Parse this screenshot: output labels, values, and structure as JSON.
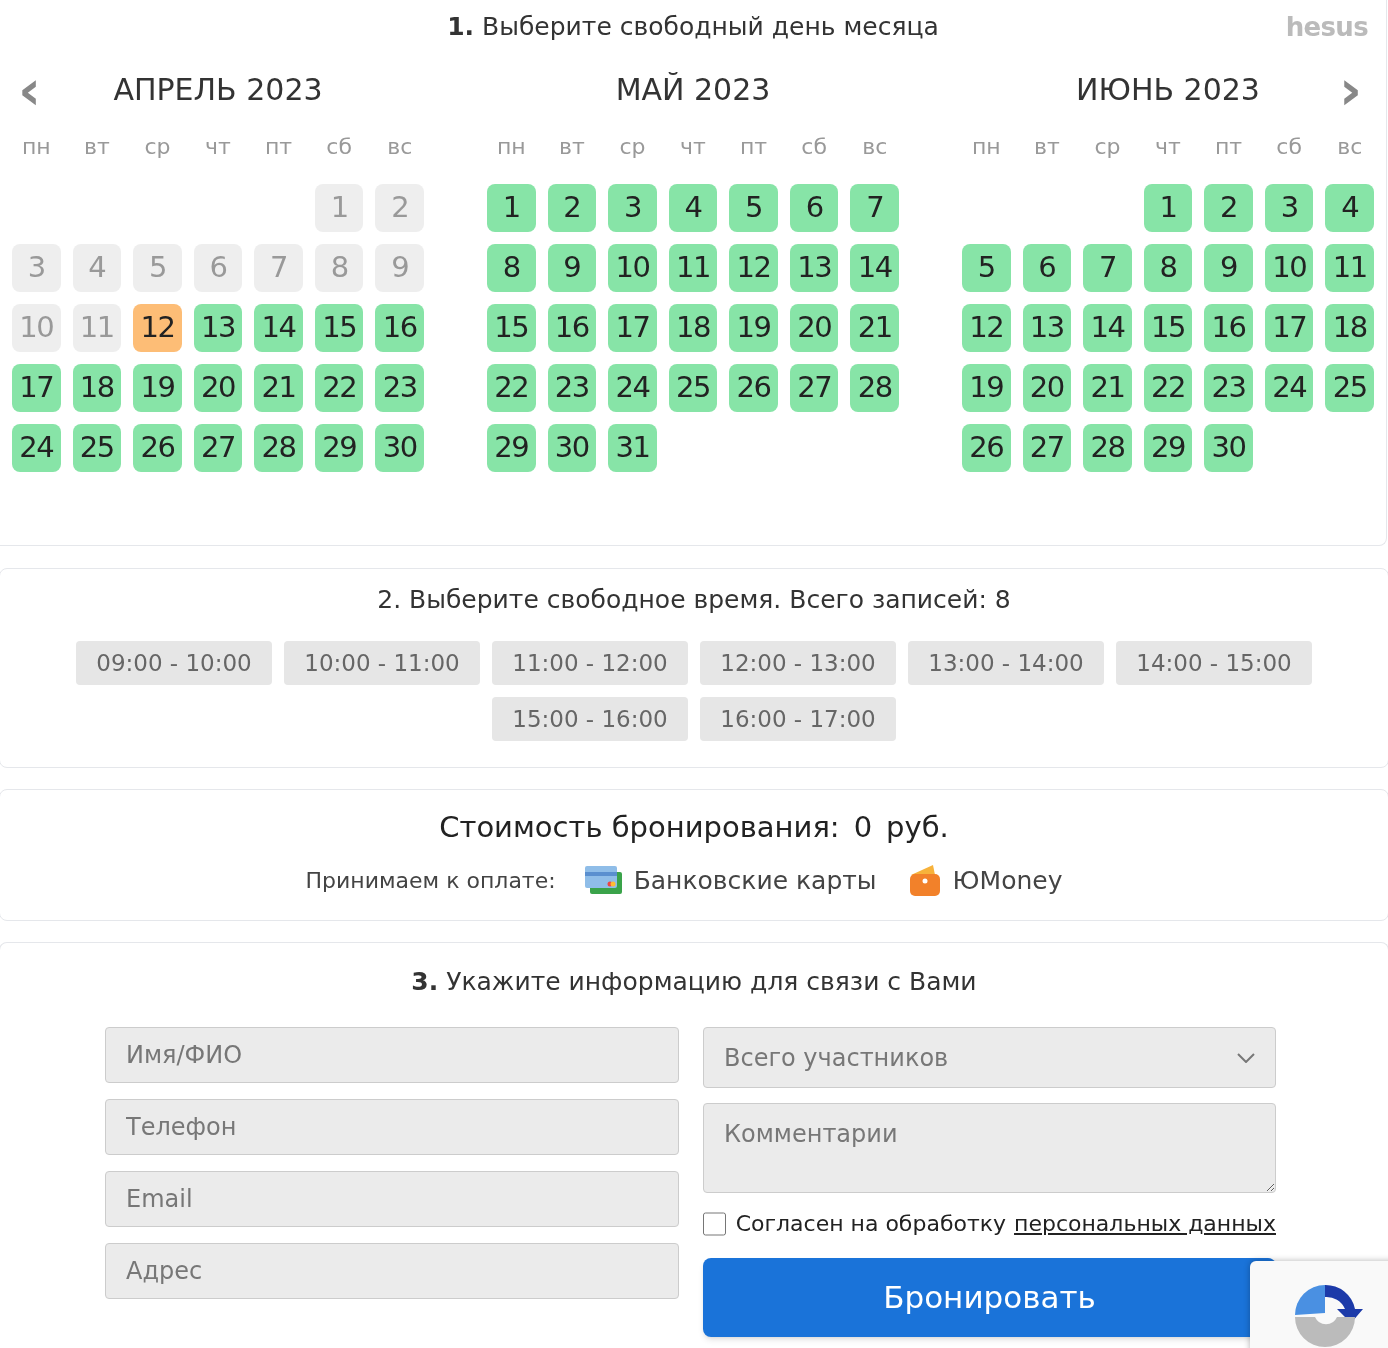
{
  "logo": "hesus",
  "step1": {
    "number": "1.",
    "title": "Выберите свободный день месяца"
  },
  "nav": {
    "prev": "‹",
    "next": "›"
  },
  "months": [
    {
      "title": "АПРЕЛЬ 2023",
      "weekdays": [
        "пн",
        "вт",
        "ср",
        "чт",
        "пт",
        "сб",
        "вс"
      ],
      "days": [
        {
          "kind": "blank"
        },
        {
          "kind": "blank"
        },
        {
          "kind": "blank"
        },
        {
          "kind": "blank"
        },
        {
          "kind": "blank"
        },
        {
          "label": "1",
          "kind": "past"
        },
        {
          "label": "2",
          "kind": "past"
        },
        {
          "label": "3",
          "kind": "past"
        },
        {
          "label": "4",
          "kind": "past"
        },
        {
          "label": "5",
          "kind": "past"
        },
        {
          "label": "6",
          "kind": "past"
        },
        {
          "label": "7",
          "kind": "past"
        },
        {
          "label": "8",
          "kind": "past"
        },
        {
          "label": "9",
          "kind": "past"
        },
        {
          "label": "10",
          "kind": "past"
        },
        {
          "label": "11",
          "kind": "past"
        },
        {
          "label": "12",
          "kind": "today"
        },
        {
          "label": "13",
          "kind": "free"
        },
        {
          "label": "14",
          "kind": "free"
        },
        {
          "label": "15",
          "kind": "free"
        },
        {
          "label": "16",
          "kind": "free"
        },
        {
          "label": "17",
          "kind": "free"
        },
        {
          "label": "18",
          "kind": "free"
        },
        {
          "label": "19",
          "kind": "free"
        },
        {
          "label": "20",
          "kind": "free"
        },
        {
          "label": "21",
          "kind": "free"
        },
        {
          "label": "22",
          "kind": "free"
        },
        {
          "label": "23",
          "kind": "free"
        },
        {
          "label": "24",
          "kind": "free"
        },
        {
          "label": "25",
          "kind": "free"
        },
        {
          "label": "26",
          "kind": "free"
        },
        {
          "label": "27",
          "kind": "free"
        },
        {
          "label": "28",
          "kind": "free"
        },
        {
          "label": "29",
          "kind": "free"
        },
        {
          "label": "30",
          "kind": "free"
        }
      ]
    },
    {
      "title": "МАЙ 2023",
      "weekdays": [
        "пн",
        "вт",
        "ср",
        "чт",
        "пт",
        "сб",
        "вс"
      ],
      "days": [
        {
          "label": "1",
          "kind": "free"
        },
        {
          "label": "2",
          "kind": "free"
        },
        {
          "label": "3",
          "kind": "free"
        },
        {
          "label": "4",
          "kind": "free"
        },
        {
          "label": "5",
          "kind": "free"
        },
        {
          "label": "6",
          "kind": "free"
        },
        {
          "label": "7",
          "kind": "free"
        },
        {
          "label": "8",
          "kind": "free"
        },
        {
          "label": "9",
          "kind": "free"
        },
        {
          "label": "10",
          "kind": "free"
        },
        {
          "label": "11",
          "kind": "free"
        },
        {
          "label": "12",
          "kind": "free"
        },
        {
          "label": "13",
          "kind": "free"
        },
        {
          "label": "14",
          "kind": "free"
        },
        {
          "label": "15",
          "kind": "free"
        },
        {
          "label": "16",
          "kind": "free"
        },
        {
          "label": "17",
          "kind": "free"
        },
        {
          "label": "18",
          "kind": "free"
        },
        {
          "label": "19",
          "kind": "free"
        },
        {
          "label": "20",
          "kind": "free"
        },
        {
          "label": "21",
          "kind": "free"
        },
        {
          "label": "22",
          "kind": "free"
        },
        {
          "label": "23",
          "kind": "free"
        },
        {
          "label": "24",
          "kind": "free"
        },
        {
          "label": "25",
          "kind": "free"
        },
        {
          "label": "26",
          "kind": "free"
        },
        {
          "label": "27",
          "kind": "free"
        },
        {
          "label": "28",
          "kind": "free"
        },
        {
          "label": "29",
          "kind": "free"
        },
        {
          "label": "30",
          "kind": "free"
        },
        {
          "label": "31",
          "kind": "free"
        }
      ]
    },
    {
      "title": "ИЮНЬ 2023",
      "weekdays": [
        "пн",
        "вт",
        "ср",
        "чт",
        "пт",
        "сб",
        "вс"
      ],
      "days": [
        {
          "kind": "blank"
        },
        {
          "kind": "blank"
        },
        {
          "kind": "blank"
        },
        {
          "label": "1",
          "kind": "free"
        },
        {
          "label": "2",
          "kind": "free"
        },
        {
          "label": "3",
          "kind": "free"
        },
        {
          "label": "4",
          "kind": "free"
        },
        {
          "label": "5",
          "kind": "free"
        },
        {
          "label": "6",
          "kind": "free"
        },
        {
          "label": "7",
          "kind": "free"
        },
        {
          "label": "8",
          "kind": "free"
        },
        {
          "label": "9",
          "kind": "free"
        },
        {
          "label": "10",
          "kind": "free"
        },
        {
          "label": "11",
          "kind": "free"
        },
        {
          "label": "12",
          "kind": "free"
        },
        {
          "label": "13",
          "kind": "free"
        },
        {
          "label": "14",
          "kind": "free"
        },
        {
          "label": "15",
          "kind": "free"
        },
        {
          "label": "16",
          "kind": "free"
        },
        {
          "label": "17",
          "kind": "free"
        },
        {
          "label": "18",
          "kind": "free"
        },
        {
          "label": "19",
          "kind": "free"
        },
        {
          "label": "20",
          "kind": "free"
        },
        {
          "label": "21",
          "kind": "free"
        },
        {
          "label": "22",
          "kind": "free"
        },
        {
          "label": "23",
          "kind": "free"
        },
        {
          "label": "24",
          "kind": "free"
        },
        {
          "label": "25",
          "kind": "free"
        },
        {
          "label": "26",
          "kind": "free"
        },
        {
          "label": "27",
          "kind": "free"
        },
        {
          "label": "28",
          "kind": "free"
        },
        {
          "label": "29",
          "kind": "free"
        },
        {
          "label": "30",
          "kind": "free"
        }
      ]
    }
  ],
  "step2": {
    "title": "2. Выберите свободное время. Всего записей: 8",
    "slots": [
      "09:00 - 10:00",
      "10:00 - 11:00",
      "11:00 - 12:00",
      "12:00 - 13:00",
      "13:00 - 14:00",
      "14:00 - 15:00",
      "15:00 - 16:00",
      "16:00 - 17:00"
    ]
  },
  "price": {
    "label": "Стоимость бронирования:",
    "amount": "0",
    "currency": "руб."
  },
  "payment": {
    "label": "Принимаем к оплате:",
    "methods": [
      {
        "kind": "cards",
        "label": "Банковские карты"
      },
      {
        "kind": "wallet",
        "label": "ЮMoney"
      }
    ]
  },
  "step3": {
    "number": "3.",
    "title": "Укажите информацию для связи с Вами"
  },
  "fields": [
    {
      "placeholder": "Имя/ФИО"
    },
    {
      "placeholder": "Телефон"
    },
    {
      "placeholder": "Email"
    },
    {
      "placeholder": "Адрес"
    }
  ],
  "participants": {
    "placeholder": "Всего участников"
  },
  "comment": {
    "placeholder": "Комментарии"
  },
  "consent": {
    "checked": false,
    "text": "Согласен на обработку",
    "link": "персональных данных"
  },
  "submit": "Бронировать"
}
